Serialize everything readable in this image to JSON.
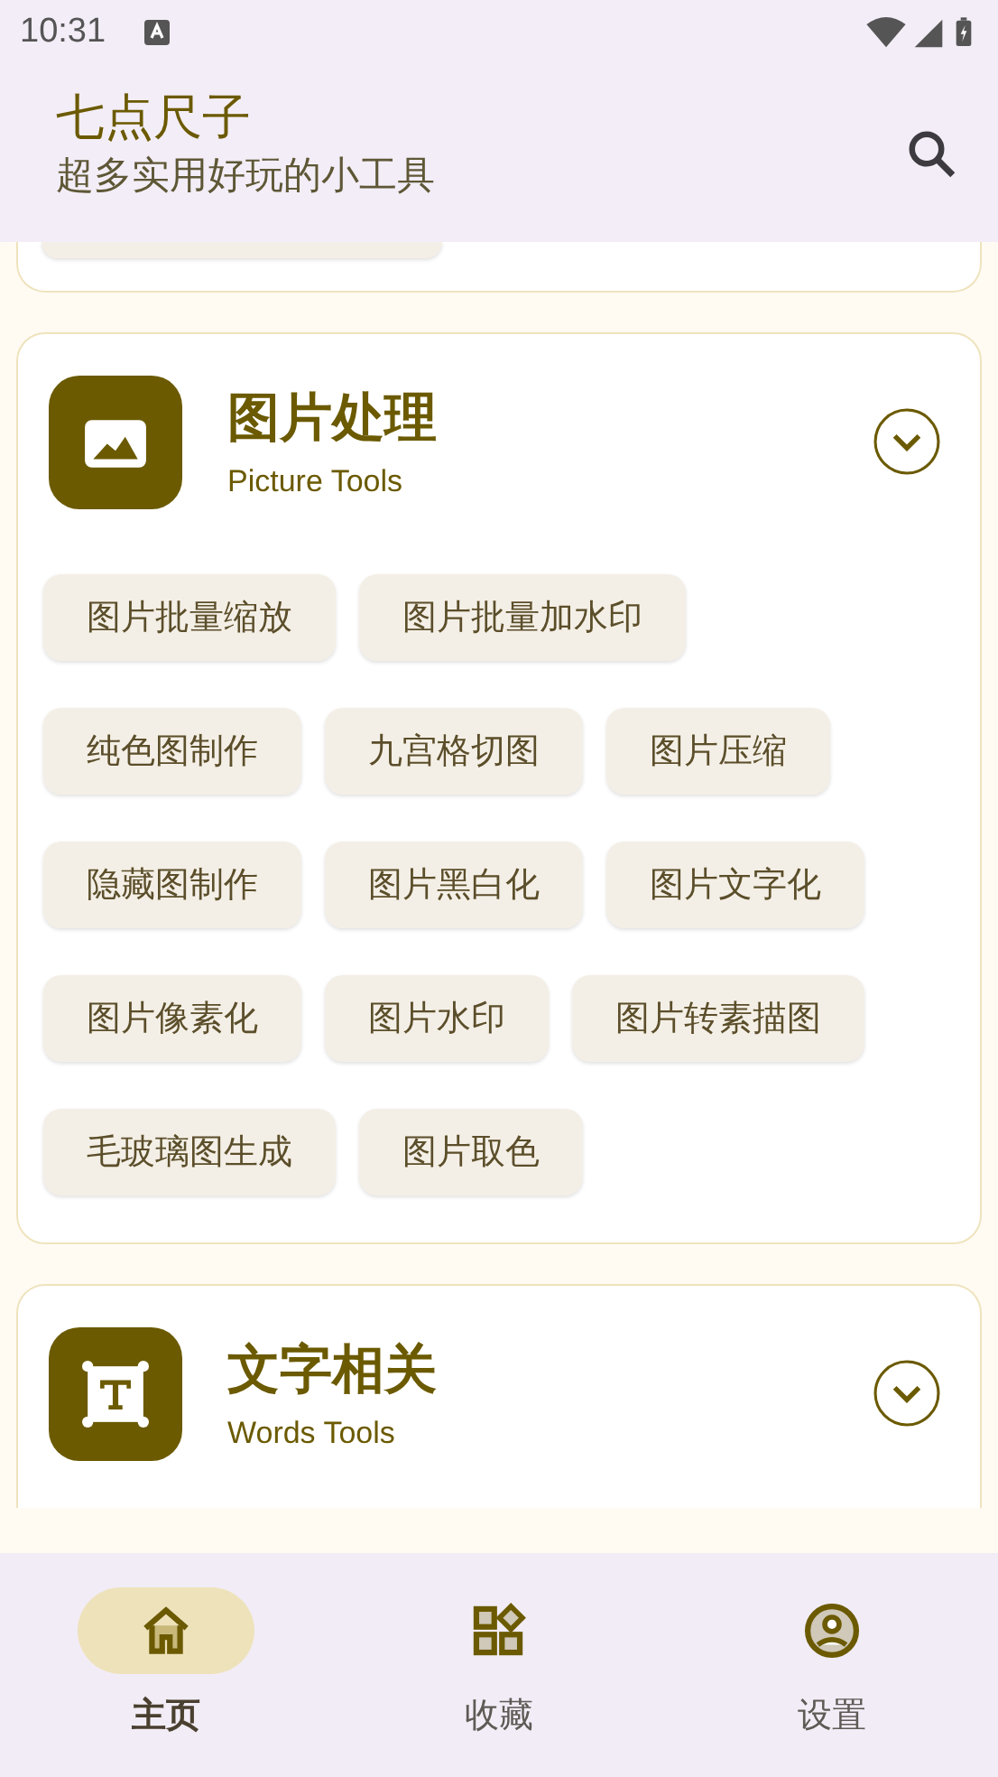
{
  "status_bar": {
    "time": "10:31"
  },
  "app_bar": {
    "title": "七点尺子",
    "subtitle": "超多实用好玩的小工具"
  },
  "sections": [
    {
      "title": "图片处理",
      "subtitle": "Picture Tools",
      "tools": [
        "图片批量缩放",
        "图片批量加水印",
        "纯色图制作",
        "九宫格切图",
        "图片压缩",
        "隐藏图制作",
        "图片黑白化",
        "图片文字化",
        "图片像素化",
        "图片水印",
        "图片转素描图",
        "毛玻璃图生成",
        "图片取色"
      ]
    },
    {
      "title": "文字相关",
      "subtitle": "Words Tools"
    }
  ],
  "nav": [
    {
      "label": "主页",
      "selected": true
    },
    {
      "label": "收藏",
      "selected": false
    },
    {
      "label": "设置",
      "selected": false
    }
  ]
}
